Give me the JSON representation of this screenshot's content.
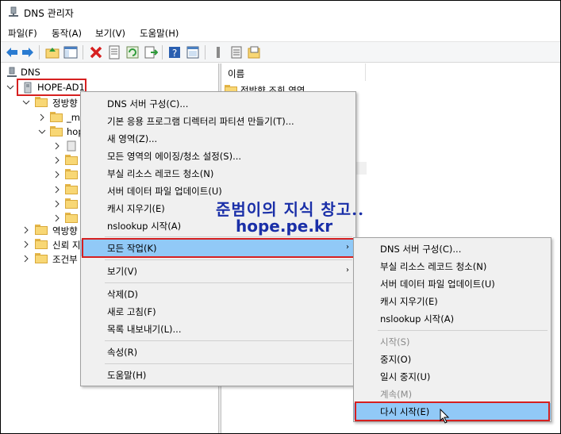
{
  "window": {
    "title": "DNS 관리자"
  },
  "menubar": [
    "파일(F)",
    "동작(A)",
    "보기(V)",
    "도움말(H)"
  ],
  "toolbar_icons": [
    "back-arrow-icon",
    "forward-arrow-icon",
    "up-folder-icon",
    "show-hide-tree-icon",
    "delete-icon",
    "properties-icon",
    "refresh-icon",
    "export-list-icon",
    "help-icon",
    "console-icon",
    "list-view-icon",
    "zone-icon",
    "folder-icon"
  ],
  "tree": {
    "root": "DNS",
    "server": "HOPE-AD1",
    "items": [
      "정방향",
      "_ms",
      "hop",
      "역방향",
      "신뢰 지",
      "조건부"
    ]
  },
  "right_pane": {
    "column_header": "이름",
    "first_row": "정방향 조회 영역"
  },
  "context_menu_main": {
    "items": [
      {
        "label": "DNS 서버 구성(C)..."
      },
      {
        "label": "기본 응용 프로그램 디렉터리 파티션 만들기(T)..."
      },
      {
        "label": "새 영역(Z)..."
      },
      {
        "label": "모든 영역의 에이징/청소 설정(S)..."
      },
      {
        "label": "부실 리소스 레코드 청소(N)"
      },
      {
        "label": "서버 데이터 파일 업데이트(U)"
      },
      {
        "label": "캐시 지우기(E)"
      },
      {
        "label": "nslookup 시작(A)"
      },
      {
        "label": "모든 작업(K)"
      },
      {
        "label": "보기(V)"
      },
      {
        "label": "삭제(D)"
      },
      {
        "label": "새로 고침(F)"
      },
      {
        "label": "목록 내보내기(L)..."
      },
      {
        "label": "속성(R)"
      },
      {
        "label": "도움말(H)"
      }
    ]
  },
  "context_menu_sub": {
    "items": [
      {
        "label": "DNS 서버 구성(C)..."
      },
      {
        "label": "부실 리소스 레코드 청소(N)"
      },
      {
        "label": "서버 데이터 파일 업데이트(U)"
      },
      {
        "label": "캐시 지우기(E)"
      },
      {
        "label": "nslookup 시작(A)"
      },
      {
        "label": "시작(S)"
      },
      {
        "label": "중지(O)"
      },
      {
        "label": "일시 중지(U)"
      },
      {
        "label": "계속(M)"
      },
      {
        "label": "다시 시작(E)"
      }
    ]
  },
  "watermark": {
    "line1": "준범이의 지식 창고..",
    "line2": "hope.pe.kr"
  },
  "colors": {
    "selection": "#91c9f7",
    "highlight_border": "#d62020",
    "watermark": "#1a2fa8"
  }
}
